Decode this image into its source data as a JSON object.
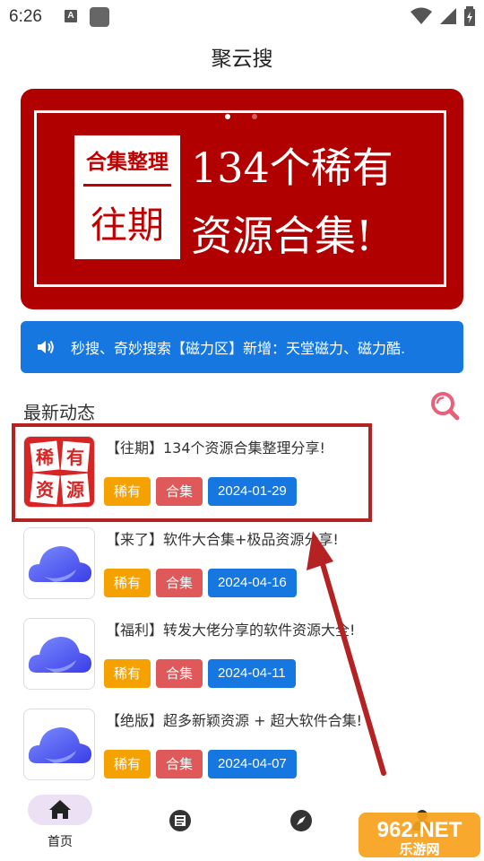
{
  "status": {
    "time": "6:26",
    "notif_letter": "A"
  },
  "app": {
    "title": "聚云搜"
  },
  "banner": {
    "box_top": "合集整理",
    "box_bottom": "往期",
    "line1": "134个稀有",
    "line2": "资源合集!"
  },
  "notice": {
    "text": "秒搜、奇妙搜索【磁力区】新增：天堂磁力、磁力酷."
  },
  "section": {
    "title": "最新动态"
  },
  "items": [
    {
      "title": "【往期】134个资源合集整理分享!",
      "tag1": "稀有",
      "tag2": "合集",
      "date": "2024-01-29",
      "thumb": "rare-resource-logo"
    },
    {
      "title": "【来了】软件大合集+极品资源分享!",
      "tag1": "稀有",
      "tag2": "合集",
      "date": "2024-04-16",
      "thumb": "cloud-logo"
    },
    {
      "title": "【福利】转发大佬分享的软件资源大全!",
      "tag1": "稀有",
      "tag2": "合集",
      "date": "2024-04-11",
      "thumb": "cloud-logo"
    },
    {
      "title": "【绝版】超多新颖资源 + 超大软件合集!",
      "tag1": "稀有",
      "tag2": "合集",
      "date": "2024-04-07",
      "thumb": "cloud-logo"
    }
  ],
  "logo_text": {
    "a": "稀",
    "b": "有",
    "c": "资",
    "d": "源"
  },
  "nav": {
    "home_label": "首页"
  },
  "watermark": {
    "main": "962.NET",
    "sub": "乐游网"
  },
  "colors": {
    "banner_red": "#b00000",
    "notice_blue": "#1677e0",
    "tag_rare": "#f5a100",
    "tag_collection": "#e0595a",
    "tag_date": "#1677e0",
    "highlight": "#b52222",
    "search_icon": "#e8607a"
  }
}
